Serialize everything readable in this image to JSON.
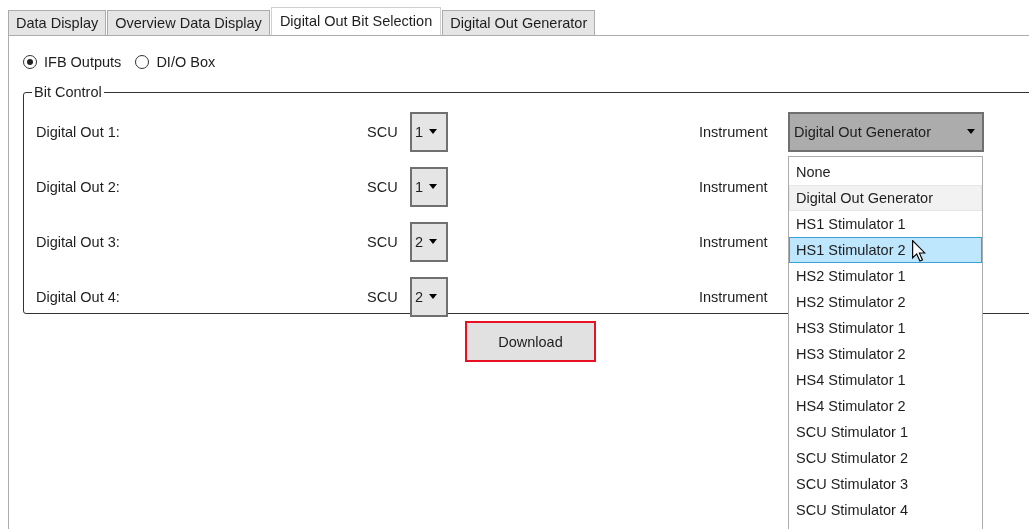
{
  "tabs": [
    {
      "label": "Data Display",
      "selected": false
    },
    {
      "label": "Overview Data Display",
      "selected": false
    },
    {
      "label": "Digital Out Bit Selection",
      "selected": true
    },
    {
      "label": "Digital Out Generator",
      "selected": false
    }
  ],
  "output_mode": [
    {
      "label": "IFB Outputs",
      "selected": true
    },
    {
      "label": "DI/O Box",
      "selected": false
    }
  ],
  "bit_control": {
    "title": "Bit Control",
    "rows": [
      {
        "label": "Digital Out 1:",
        "scu_label": "SCU",
        "scu": "1",
        "instrument_label": "Instrument",
        "instrument": "Digital Out Generator",
        "open": true
      },
      {
        "label": "Digital Out 2:",
        "scu_label": "SCU",
        "scu": "1",
        "instrument_label": "Instrument"
      },
      {
        "label": "Digital Out 3:",
        "scu_label": "SCU",
        "scu": "2",
        "instrument_label": "Instrument"
      },
      {
        "label": "Digital Out 4:",
        "scu_label": "SCU",
        "scu": "2",
        "instrument_label": "Instrument"
      }
    ]
  },
  "download_button": "Download",
  "instrument_options": [
    {
      "label": "None",
      "current": false,
      "selected": false
    },
    {
      "label": "Digital Out Generator",
      "current": true,
      "selected": false
    },
    {
      "label": "HS1 Stimulator 1",
      "current": false,
      "selected": false
    },
    {
      "label": "HS1 Stimulator 2",
      "current": false,
      "selected": true
    },
    {
      "label": "HS2 Stimulator 1",
      "current": false,
      "selected": false
    },
    {
      "label": "HS2 Stimulator 2",
      "current": false,
      "selected": false
    },
    {
      "label": "HS3 Stimulator 1",
      "current": false,
      "selected": false
    },
    {
      "label": "HS3 Stimulator 2",
      "current": false,
      "selected": false
    },
    {
      "label": "HS4 Stimulator 1",
      "current": false,
      "selected": false
    },
    {
      "label": "HS4 Stimulator 2",
      "current": false,
      "selected": false
    },
    {
      "label": "SCU Stimulator 1",
      "current": false,
      "selected": false
    },
    {
      "label": "SCU Stimulator 2",
      "current": false,
      "selected": false
    },
    {
      "label": "SCU Stimulator 3",
      "current": false,
      "selected": false
    },
    {
      "label": "SCU Stimulator 4",
      "current": false,
      "selected": false
    }
  ]
}
